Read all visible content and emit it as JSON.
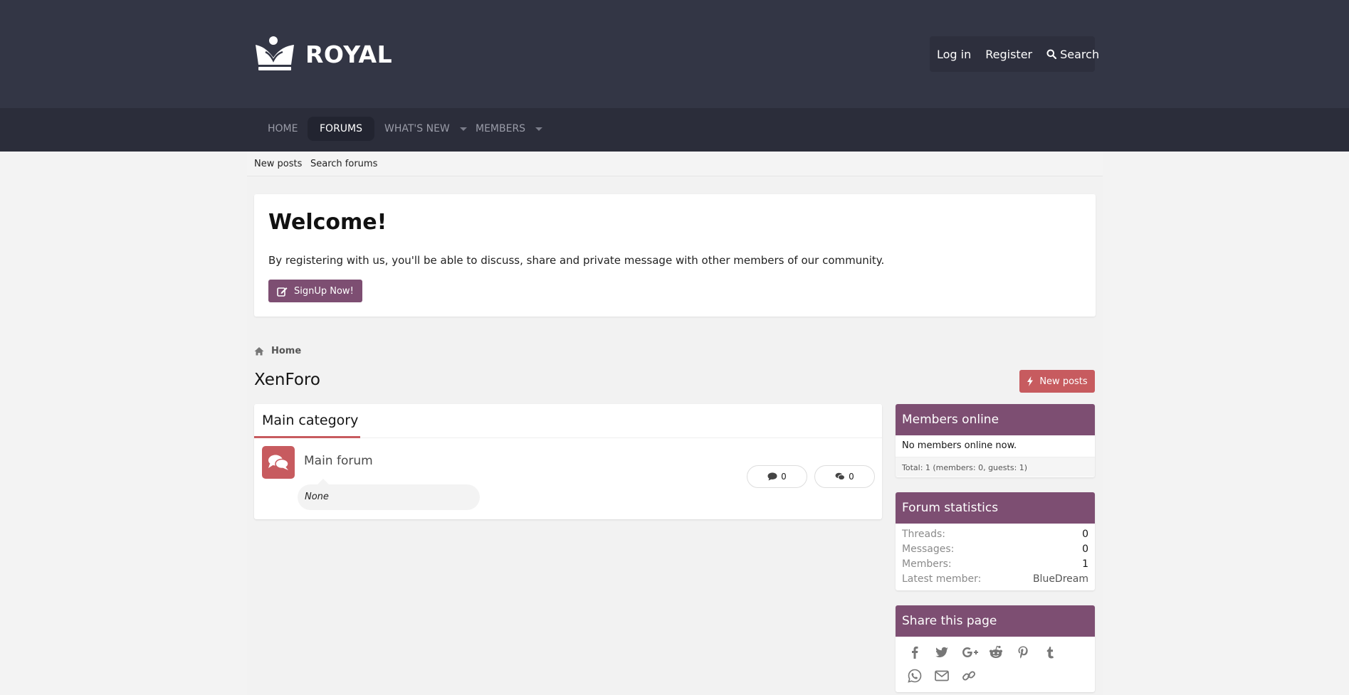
{
  "header": {
    "logo_text": "ROYAL",
    "login_label": "Log in",
    "register_label": "Register",
    "search_label": "Search"
  },
  "nav": {
    "tabs": [
      {
        "label": "HOME"
      },
      {
        "label": "FORUMS"
      },
      {
        "label": "WHAT'S NEW"
      },
      {
        "label": "MEMBERS"
      }
    ],
    "active_tab": "FORUMS"
  },
  "subnav": {
    "links": [
      {
        "label": "New posts"
      },
      {
        "label": "Search forums"
      }
    ]
  },
  "welcome": {
    "title": "Welcome!",
    "text": "By registering with us, you'll be able to discuss, share and private message with other members of our community.",
    "button_label": "SignUp Now!"
  },
  "breadcrumb": {
    "home_label": "Home"
  },
  "page": {
    "title": "XenForo",
    "new_posts_label": "New posts"
  },
  "forum_block": {
    "category_title": "Main category",
    "forums": [
      {
        "title": "Main forum",
        "threads": "0",
        "messages": "0",
        "last_post": "None"
      }
    ]
  },
  "sidebar": {
    "members_online": {
      "title": "Members online",
      "status": "No members online now.",
      "total": "Total: 1 (members: 0, guests: 1)"
    },
    "forum_statistics": {
      "title": "Forum statistics",
      "rows": [
        {
          "label": "Threads:",
          "value": "0"
        },
        {
          "label": "Messages:",
          "value": "0"
        },
        {
          "label": "Members:",
          "value": "1"
        },
        {
          "label": "Latest member:",
          "value": "BlueDream"
        }
      ]
    },
    "share": {
      "title": "Share this page",
      "icons": [
        "facebook-icon",
        "twitter-icon",
        "google-plus-icon",
        "reddit-icon",
        "pinterest-icon",
        "tumblr-icon",
        "whatsapp-icon",
        "email-icon",
        "link-icon"
      ]
    }
  },
  "colors": {
    "header_bg": "#333645",
    "nav_bg": "#2b2d3a",
    "accent_purple": "#7d4e72",
    "accent_red": "#c75b5f",
    "page_bg": "#f3f3f3"
  }
}
